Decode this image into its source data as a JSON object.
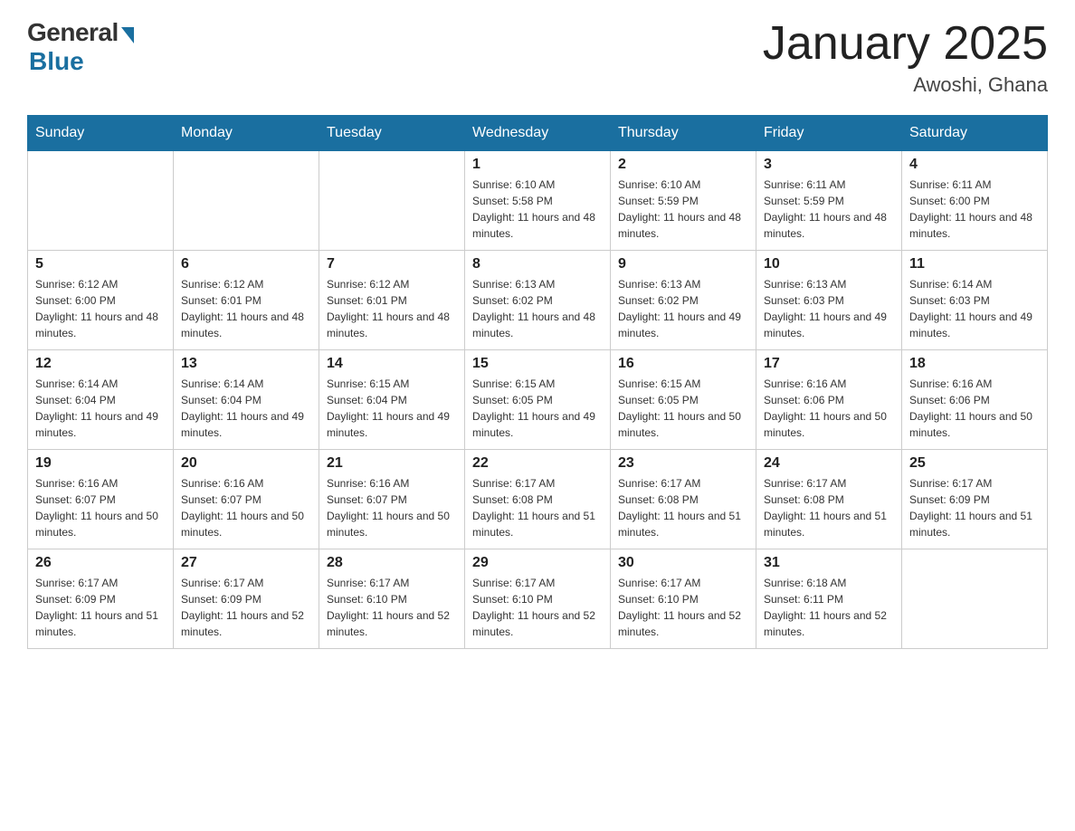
{
  "header": {
    "logo_general": "General",
    "logo_blue": "Blue",
    "month_title": "January 2025",
    "location": "Awoshi, Ghana"
  },
  "weekdays": [
    "Sunday",
    "Monday",
    "Tuesday",
    "Wednesday",
    "Thursday",
    "Friday",
    "Saturday"
  ],
  "weeks": [
    [
      {
        "day": "",
        "info": ""
      },
      {
        "day": "",
        "info": ""
      },
      {
        "day": "",
        "info": ""
      },
      {
        "day": "1",
        "info": "Sunrise: 6:10 AM\nSunset: 5:58 PM\nDaylight: 11 hours and 48 minutes."
      },
      {
        "day": "2",
        "info": "Sunrise: 6:10 AM\nSunset: 5:59 PM\nDaylight: 11 hours and 48 minutes."
      },
      {
        "day": "3",
        "info": "Sunrise: 6:11 AM\nSunset: 5:59 PM\nDaylight: 11 hours and 48 minutes."
      },
      {
        "day": "4",
        "info": "Sunrise: 6:11 AM\nSunset: 6:00 PM\nDaylight: 11 hours and 48 minutes."
      }
    ],
    [
      {
        "day": "5",
        "info": "Sunrise: 6:12 AM\nSunset: 6:00 PM\nDaylight: 11 hours and 48 minutes."
      },
      {
        "day": "6",
        "info": "Sunrise: 6:12 AM\nSunset: 6:01 PM\nDaylight: 11 hours and 48 minutes."
      },
      {
        "day": "7",
        "info": "Sunrise: 6:12 AM\nSunset: 6:01 PM\nDaylight: 11 hours and 48 minutes."
      },
      {
        "day": "8",
        "info": "Sunrise: 6:13 AM\nSunset: 6:02 PM\nDaylight: 11 hours and 48 minutes."
      },
      {
        "day": "9",
        "info": "Sunrise: 6:13 AM\nSunset: 6:02 PM\nDaylight: 11 hours and 49 minutes."
      },
      {
        "day": "10",
        "info": "Sunrise: 6:13 AM\nSunset: 6:03 PM\nDaylight: 11 hours and 49 minutes."
      },
      {
        "day": "11",
        "info": "Sunrise: 6:14 AM\nSunset: 6:03 PM\nDaylight: 11 hours and 49 minutes."
      }
    ],
    [
      {
        "day": "12",
        "info": "Sunrise: 6:14 AM\nSunset: 6:04 PM\nDaylight: 11 hours and 49 minutes."
      },
      {
        "day": "13",
        "info": "Sunrise: 6:14 AM\nSunset: 6:04 PM\nDaylight: 11 hours and 49 minutes."
      },
      {
        "day": "14",
        "info": "Sunrise: 6:15 AM\nSunset: 6:04 PM\nDaylight: 11 hours and 49 minutes."
      },
      {
        "day": "15",
        "info": "Sunrise: 6:15 AM\nSunset: 6:05 PM\nDaylight: 11 hours and 49 minutes."
      },
      {
        "day": "16",
        "info": "Sunrise: 6:15 AM\nSunset: 6:05 PM\nDaylight: 11 hours and 50 minutes."
      },
      {
        "day": "17",
        "info": "Sunrise: 6:16 AM\nSunset: 6:06 PM\nDaylight: 11 hours and 50 minutes."
      },
      {
        "day": "18",
        "info": "Sunrise: 6:16 AM\nSunset: 6:06 PM\nDaylight: 11 hours and 50 minutes."
      }
    ],
    [
      {
        "day": "19",
        "info": "Sunrise: 6:16 AM\nSunset: 6:07 PM\nDaylight: 11 hours and 50 minutes."
      },
      {
        "day": "20",
        "info": "Sunrise: 6:16 AM\nSunset: 6:07 PM\nDaylight: 11 hours and 50 minutes."
      },
      {
        "day": "21",
        "info": "Sunrise: 6:16 AM\nSunset: 6:07 PM\nDaylight: 11 hours and 50 minutes."
      },
      {
        "day": "22",
        "info": "Sunrise: 6:17 AM\nSunset: 6:08 PM\nDaylight: 11 hours and 51 minutes."
      },
      {
        "day": "23",
        "info": "Sunrise: 6:17 AM\nSunset: 6:08 PM\nDaylight: 11 hours and 51 minutes."
      },
      {
        "day": "24",
        "info": "Sunrise: 6:17 AM\nSunset: 6:08 PM\nDaylight: 11 hours and 51 minutes."
      },
      {
        "day": "25",
        "info": "Sunrise: 6:17 AM\nSunset: 6:09 PM\nDaylight: 11 hours and 51 minutes."
      }
    ],
    [
      {
        "day": "26",
        "info": "Sunrise: 6:17 AM\nSunset: 6:09 PM\nDaylight: 11 hours and 51 minutes."
      },
      {
        "day": "27",
        "info": "Sunrise: 6:17 AM\nSunset: 6:09 PM\nDaylight: 11 hours and 52 minutes."
      },
      {
        "day": "28",
        "info": "Sunrise: 6:17 AM\nSunset: 6:10 PM\nDaylight: 11 hours and 52 minutes."
      },
      {
        "day": "29",
        "info": "Sunrise: 6:17 AM\nSunset: 6:10 PM\nDaylight: 11 hours and 52 minutes."
      },
      {
        "day": "30",
        "info": "Sunrise: 6:17 AM\nSunset: 6:10 PM\nDaylight: 11 hours and 52 minutes."
      },
      {
        "day": "31",
        "info": "Sunrise: 6:18 AM\nSunset: 6:11 PM\nDaylight: 11 hours and 52 minutes."
      },
      {
        "day": "",
        "info": ""
      }
    ]
  ]
}
